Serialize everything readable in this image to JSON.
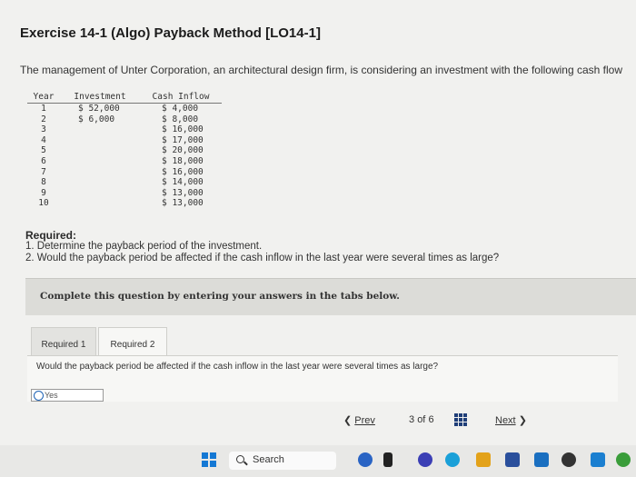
{
  "title": "Exercise 14-1 (Algo) Payback Method [LO14-1]",
  "intro": "The management of Unter Corporation, an architectural design firm, is considering an investment with the following cash flow",
  "table": {
    "headers": [
      "Year",
      "Investment",
      "Cash Inflow"
    ],
    "rows": [
      {
        "year": "1",
        "investment": "$ 52,000",
        "inflow": "$ 4,000"
      },
      {
        "year": "2",
        "investment": "$ 6,000",
        "inflow": "$ 8,000"
      },
      {
        "year": "3",
        "investment": "",
        "inflow": "$ 16,000"
      },
      {
        "year": "4",
        "investment": "",
        "inflow": "$ 17,000"
      },
      {
        "year": "5",
        "investment": "",
        "inflow": "$ 20,000"
      },
      {
        "year": "6",
        "investment": "",
        "inflow": "$ 18,000"
      },
      {
        "year": "7",
        "investment": "",
        "inflow": "$ 16,000"
      },
      {
        "year": "8",
        "investment": "",
        "inflow": "$ 14,000"
      },
      {
        "year": "9",
        "investment": "",
        "inflow": "$ 13,000"
      },
      {
        "year": "10",
        "investment": "",
        "inflow": "$ 13,000"
      }
    ]
  },
  "required": {
    "heading": "Required:",
    "items": [
      "1. Determine the payback period of the investment.",
      "2. Would the payback period be affected if the cash inflow in the last year were several times as large?"
    ]
  },
  "instructions": "Complete this question by entering your answers in the tabs below.",
  "tabs": [
    "Required 1",
    "Required 2"
  ],
  "question": "Would the payback period be affected if the cash inflow in the last year were several times as large?",
  "answer": {
    "selected": "Yes"
  },
  "nav": {
    "prev": "Prev",
    "page_current": "3",
    "page_of": "of",
    "page_total": "6",
    "next": "Next"
  },
  "taskbar": {
    "search_label": "Search"
  },
  "colors": {
    "accent_blue": "#1e63b5",
    "nav_icon": "#1f3e78",
    "windows_blue": "#1478d4"
  }
}
